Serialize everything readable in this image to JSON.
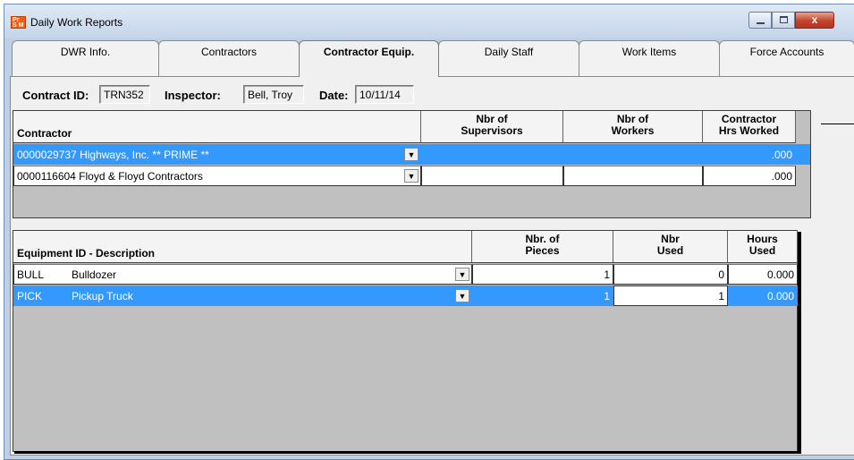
{
  "window": {
    "title": "Daily Work Reports",
    "logo_text_top": "Pr",
    "logo_text_bottom": "S M",
    "minimize_label": "",
    "close_label": "x"
  },
  "tabs": [
    {
      "label": "DWR Info."
    },
    {
      "label": "Contractors"
    },
    {
      "label": "Contractor Equip."
    },
    {
      "label": "Daily Staff"
    },
    {
      "label": "Work Items"
    },
    {
      "label": "Force Accounts"
    }
  ],
  "header": {
    "contract_id_label": "Contract ID:",
    "contract_id_value": "TRN352",
    "inspector_label": "Inspector:",
    "inspector_value": "Bell, Troy",
    "date_label": "Date:",
    "date_value": "10/11/14"
  },
  "contractor_grid": {
    "columns": [
      {
        "line1": "",
        "line2": "Contractor"
      },
      {
        "line1": "Nbr of",
        "line2": "Supervisors"
      },
      {
        "line1": "Nbr of",
        "line2": "Workers"
      },
      {
        "line1": "Contractor",
        "line2": "Hrs Worked"
      }
    ],
    "rows": [
      {
        "contractor": "0000029737  Highways, Inc.   ** PRIME **",
        "supervisors": "",
        "workers": "",
        "hrs": ".000",
        "selected": true
      },
      {
        "contractor": "0000116604  Floyd & Floyd Contractors",
        "supervisors": "",
        "workers": "",
        "hrs": ".000",
        "selected": false
      }
    ]
  },
  "equipment_grid": {
    "columns": [
      {
        "line1": "",
        "line2": "Equipment ID - Description"
      },
      {
        "line1": "Nbr. of",
        "line2": "Pieces"
      },
      {
        "line1": "Nbr",
        "line2": "Used"
      },
      {
        "line1": "Hours",
        "line2": "Used"
      }
    ],
    "rows": [
      {
        "id": "BULL",
        "description": "Bulldozer",
        "pieces": "1",
        "used": "0",
        "hours": "0.000",
        "selected": false
      },
      {
        "id": "PICK",
        "description": "Pickup Truck",
        "pieces": "1",
        "used": "1",
        "hours": "0.000",
        "selected": true
      }
    ]
  },
  "colors": {
    "selection": "#3399ff",
    "title_gradient_top": "#dfe9f5",
    "close_button": "#c4432b"
  },
  "icons": {
    "dropdown": "▼"
  }
}
